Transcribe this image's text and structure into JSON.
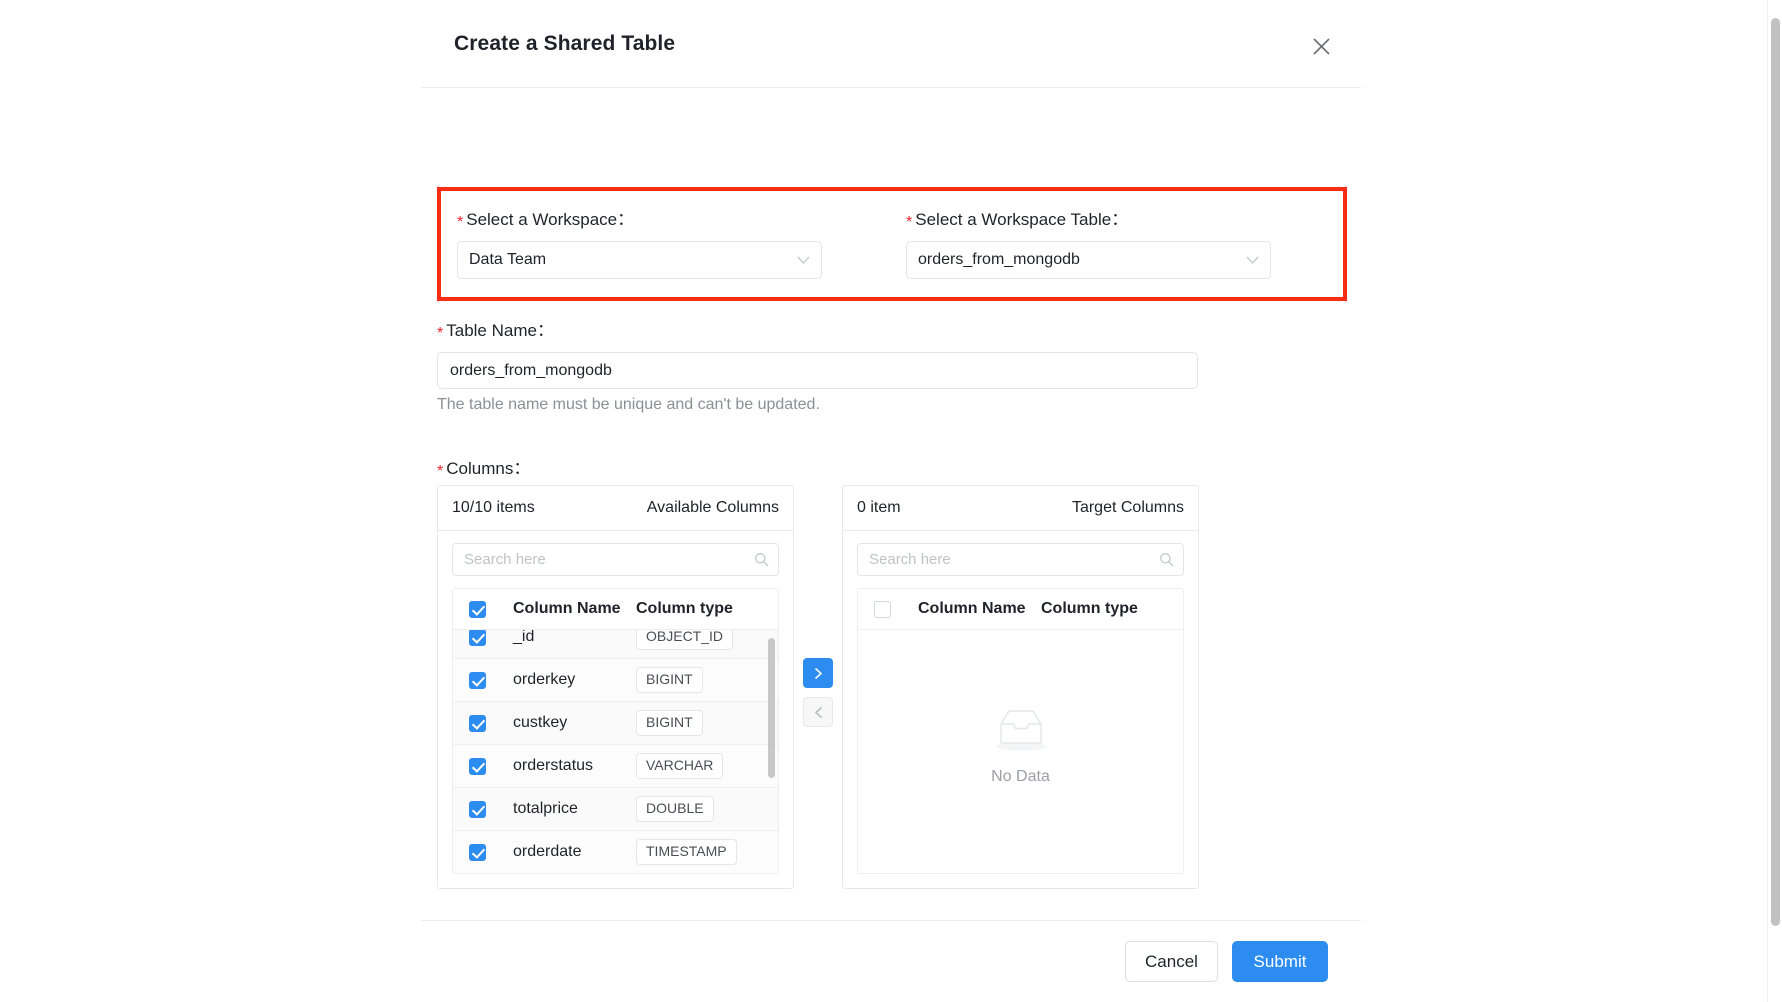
{
  "dialog": {
    "title": "Create a Shared Table",
    "close_icon": "close-icon"
  },
  "workspace_section": {
    "highlight_color": "#fa2d10",
    "workspace": {
      "required_mark": "*",
      "label": "Select a Workspace",
      "colon": "：",
      "value": "Data Team",
      "caret_icon": "chevron-down-icon"
    },
    "workspace_table": {
      "required_mark": "*",
      "label": "Select a Workspace Table",
      "colon": "：",
      "value": "orders_from_mongodb",
      "caret_icon": "chevron-down-icon"
    }
  },
  "table_name": {
    "required_mark": "*",
    "label": "Table Name",
    "colon": "：",
    "value": "orders_from_mongodb",
    "placeholder": "",
    "hint": "The table name must be unique and can't be updated."
  },
  "columns": {
    "required_mark": "*",
    "label": "Columns",
    "colon": "：",
    "available": {
      "count_label": "10/10 items",
      "title": "Available Columns",
      "search_placeholder": "Search here",
      "search_value": "",
      "search_icon": "search-icon",
      "header_all_checked": true,
      "headers": {
        "name": "Column Name",
        "type": "Column type"
      },
      "rows": [
        {
          "name": "_id",
          "type": "OBJECT_ID",
          "checked": true
        },
        {
          "name": "orderkey",
          "type": "BIGINT",
          "checked": true
        },
        {
          "name": "custkey",
          "type": "BIGINT",
          "checked": true
        },
        {
          "name": "orderstatus",
          "type": "VARCHAR",
          "checked": true
        },
        {
          "name": "totalprice",
          "type": "DOUBLE",
          "checked": true
        },
        {
          "name": "orderdate",
          "type": "TIMESTAMP",
          "checked": true
        }
      ]
    },
    "target": {
      "count_label": "0 item",
      "title": "Target Columns",
      "search_placeholder": "Search here",
      "search_value": "",
      "search_icon": "search-icon",
      "header_all_checked": false,
      "headers": {
        "name": "Column Name",
        "type": "Column type"
      },
      "empty_text": "No Data",
      "empty_icon": "empty-inbox-icon",
      "rows": []
    },
    "transfer": {
      "to_target_icon": "chevron-right-icon",
      "to_source_icon": "chevron-left-icon"
    }
  },
  "footer": {
    "cancel_label": "Cancel",
    "submit_label": "Submit",
    "submit_color": "#2d8cf0"
  }
}
